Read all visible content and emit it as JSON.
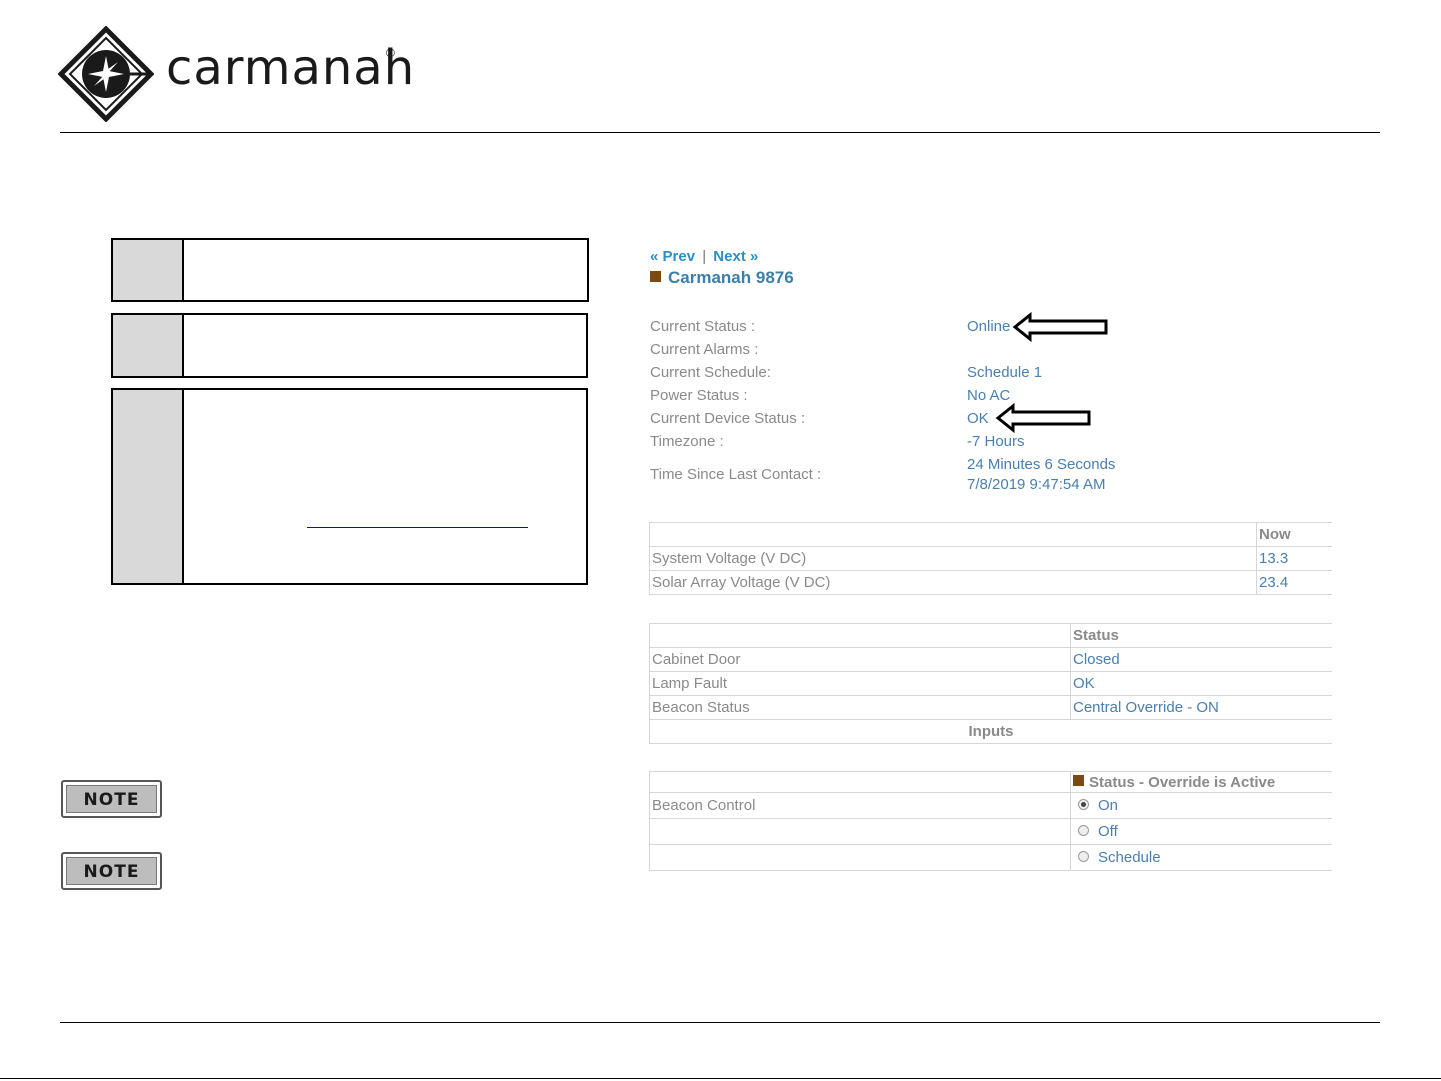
{
  "brand": {
    "name": "carmanah",
    "registered": "®"
  },
  "nav": {
    "prev": "« Prev",
    "separator": "|",
    "next": "Next »"
  },
  "device": {
    "title": "Carmanah 9876"
  },
  "info": [
    {
      "label": "Current Status :",
      "value": "Online"
    },
    {
      "label": "Current Alarms :",
      "value": ""
    },
    {
      "label": "Current Schedule:",
      "value": "Schedule 1"
    },
    {
      "label": "Power Status :",
      "value": "No AC"
    },
    {
      "label": "Current Device Status :",
      "value": "OK"
    },
    {
      "label": "Timezone :",
      "value": "-7 Hours"
    },
    {
      "label": "Time Since Last Contact :",
      "value": "24 Minutes 6 Seconds",
      "value2": "7/8/2019 9:47:54 AM"
    }
  ],
  "voltage_table": {
    "header": "Now",
    "rows": [
      {
        "label": "System Voltage (V DC)",
        "value": "13.3"
      },
      {
        "label": "Solar Array Voltage (V DC)",
        "value": "23.4"
      }
    ]
  },
  "status_table": {
    "header": "Status",
    "rows": [
      {
        "label": "Cabinet Door",
        "value": "Closed"
      },
      {
        "label": "Lamp Fault",
        "value": "OK"
      },
      {
        "label": "Beacon Status",
        "value": "Central Override - ON"
      }
    ],
    "footer": "Inputs"
  },
  "control_table": {
    "header": "Status - Override is Active",
    "label": "Beacon Control",
    "options": [
      {
        "label": "On",
        "selected": true
      },
      {
        "label": "Off",
        "selected": false
      },
      {
        "label": "Schedule",
        "selected": false
      }
    ]
  },
  "notes": [
    {
      "label": "NOTE"
    },
    {
      "label": "NOTE"
    }
  ],
  "colors": {
    "link": "#2a8fc4",
    "value": "#4a7fae",
    "label": "#8a8a8a",
    "status_square": "#7a4a12",
    "step_number_bg": "#d9d9d9"
  }
}
